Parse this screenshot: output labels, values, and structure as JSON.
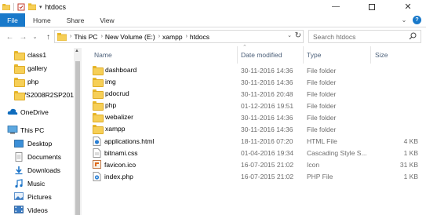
{
  "window": {
    "title": "htdocs",
    "controls": [
      "minimize-icon",
      "maximize-icon",
      "close-icon"
    ]
  },
  "ribbon": {
    "tabs": [
      "File",
      "Home",
      "Share",
      "View"
    ],
    "help_label": "?"
  },
  "address": {
    "crumbs": [
      "This PC",
      "New Volume (E:)",
      "xampp",
      "htdocs"
    ],
    "search_placeholder": "Search htdocs"
  },
  "nav": {
    "items": [
      {
        "label": "class1",
        "icon": "folder-icon"
      },
      {
        "label": "gallery",
        "icon": "folder-icon"
      },
      {
        "label": "php",
        "icon": "folder-icon"
      },
      {
        "label": "WS2008R2SP201",
        "icon": "folder-icon"
      },
      {
        "label": "OneDrive",
        "icon": "onedrive-icon"
      },
      {
        "label": "This PC",
        "icon": "this-pc-icon"
      },
      {
        "label": "Desktop",
        "icon": "desktop-icon"
      },
      {
        "label": "Documents",
        "icon": "documents-icon"
      },
      {
        "label": "Downloads",
        "icon": "downloads-icon"
      },
      {
        "label": "Music",
        "icon": "music-icon"
      },
      {
        "label": "Pictures",
        "icon": "pictures-icon"
      },
      {
        "label": "Videos",
        "icon": "videos-icon"
      }
    ]
  },
  "columns": {
    "name": "Name",
    "date": "Date modified",
    "type": "Type",
    "size": "Size"
  },
  "files": [
    {
      "name": "dashboard",
      "date": "30-11-2016 14:36",
      "type": "File folder",
      "size": "",
      "icon": "folder-icon"
    },
    {
      "name": "img",
      "date": "30-11-2016 14:36",
      "type": "File folder",
      "size": "",
      "icon": "folder-icon"
    },
    {
      "name": "pdocrud",
      "date": "30-11-2016 20:48",
      "type": "File folder",
      "size": "",
      "icon": "folder-icon"
    },
    {
      "name": "php",
      "date": "01-12-2016 19:51",
      "type": "File folder",
      "size": "",
      "icon": "folder-icon"
    },
    {
      "name": "webalizer",
      "date": "30-11-2016 14:36",
      "type": "File folder",
      "size": "",
      "icon": "folder-icon"
    },
    {
      "name": "xampp",
      "date": "30-11-2016 14:36",
      "type": "File folder",
      "size": "",
      "icon": "folder-icon"
    },
    {
      "name": "applications.html",
      "date": "18-11-2016 07:20",
      "type": "HTML File",
      "size": "4 KB",
      "icon": "html-file-icon"
    },
    {
      "name": "bitnami.css",
      "date": "01-04-2016 19:34",
      "type": "Cascading Style S...",
      "size": "1 KB",
      "icon": "css-file-icon"
    },
    {
      "name": "favicon.ico",
      "date": "16-07-2015 21:02",
      "type": "Icon",
      "size": "31 KB",
      "icon": "ico-file-icon"
    },
    {
      "name": "index.php",
      "date": "16-07-2015 21:02",
      "type": "PHP File",
      "size": "1 KB",
      "icon": "php-file-icon"
    }
  ],
  "colors": {
    "accent": "#1979ca",
    "folder": "#f6cf57",
    "header_text": "#4c607a"
  }
}
